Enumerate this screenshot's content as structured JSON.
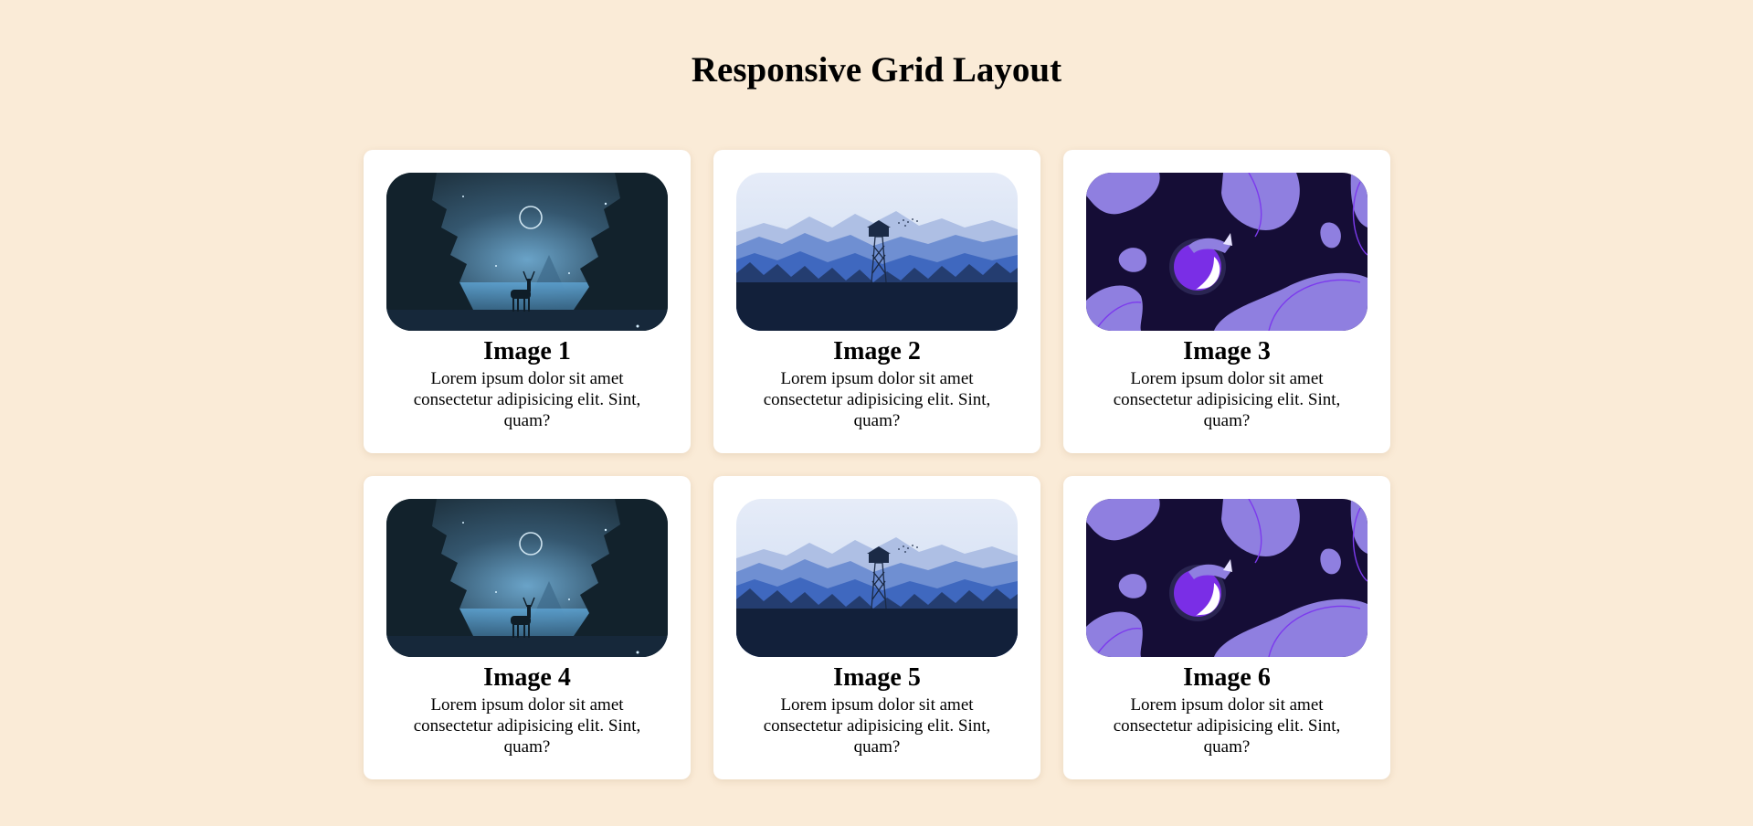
{
  "page": {
    "title": "Responsive Grid Layout",
    "background": "#faebd7"
  },
  "cards": [
    {
      "title": "Image 1",
      "text": "Lorem ipsum dolor sit amet consectetur adipisicing elit. Sint, quam?",
      "image": "night-forest-deer"
    },
    {
      "title": "Image 2",
      "text": "Lorem ipsum dolor sit amet consectetur adipisicing elit. Sint, quam?",
      "image": "blue-mountains-watchtower"
    },
    {
      "title": "Image 3",
      "text": "Lorem ipsum dolor sit amet consectetur adipisicing elit. Sint, quam?",
      "image": "purple-abstract-logo"
    },
    {
      "title": "Image 4",
      "text": "Lorem ipsum dolor sit amet consectetur adipisicing elit. Sint, quam?",
      "image": "night-forest-deer"
    },
    {
      "title": "Image 5",
      "text": "Lorem ipsum dolor sit amet consectetur adipisicing elit. Sint, quam?",
      "image": "blue-mountains-watchtower"
    },
    {
      "title": "Image 6",
      "text": "Lorem ipsum dolor sit amet consectetur adipisicing elit. Sint, quam?",
      "image": "purple-abstract-logo"
    }
  ]
}
